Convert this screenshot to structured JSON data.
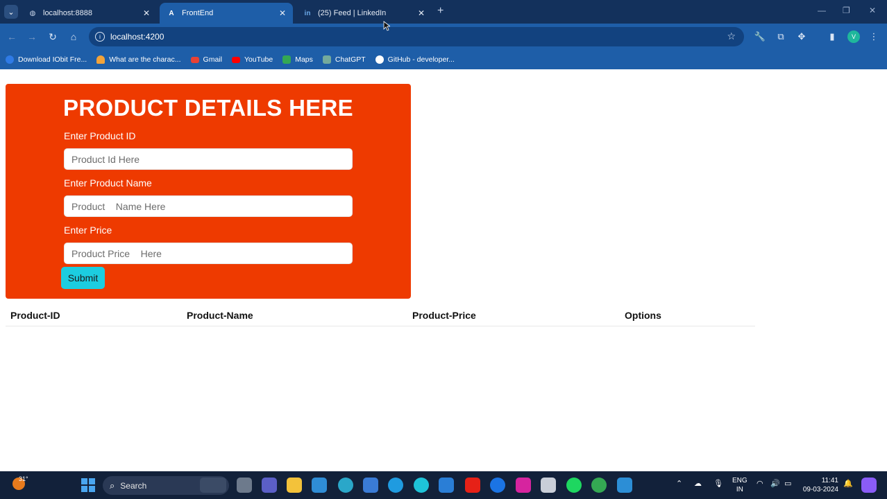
{
  "browser": {
    "tabs": [
      {
        "label": "localhost:8888",
        "active": false
      },
      {
        "label": "FrontEnd",
        "active": true
      },
      {
        "label": "(25) Feed | LinkedIn",
        "active": false
      }
    ],
    "address": "localhost:4200",
    "profile_initial": "V",
    "bookmarks": [
      {
        "label": "Download IObit Fre...",
        "color": "#2f7be6"
      },
      {
        "label": "What are the charac...",
        "color": "#f2a33a"
      },
      {
        "label": "Gmail",
        "color": "#e94235"
      },
      {
        "label": "YouTube",
        "color": "#ff0000"
      },
      {
        "label": "Maps",
        "color": "#34a853"
      },
      {
        "label": "ChatGPT",
        "color": "#74aa9c"
      },
      {
        "label": "GitHub - developer...",
        "color": "#ffffff"
      }
    ]
  },
  "form": {
    "title": "PRODUCT DETAILS HERE",
    "id_label": "Enter Product ID",
    "id_placeholder": "Product Id Here",
    "name_label": "Enter Product Name",
    "name_placeholder": "Product    Name Here",
    "price_label": "Enter Price",
    "price_placeholder": "Product Price    Here",
    "submit_label": "Submit",
    "background": "#ee3a00",
    "button_color": "#1ccde0"
  },
  "table": {
    "headers": [
      "Product-ID",
      "Product-Name",
      "Product-Price",
      "Options"
    ]
  },
  "taskbar": {
    "temperature": "31°",
    "search_label": "Search",
    "lang_line1": "ENG",
    "lang_line2": "IN",
    "time": "11:41",
    "date": "09-03-2024"
  }
}
